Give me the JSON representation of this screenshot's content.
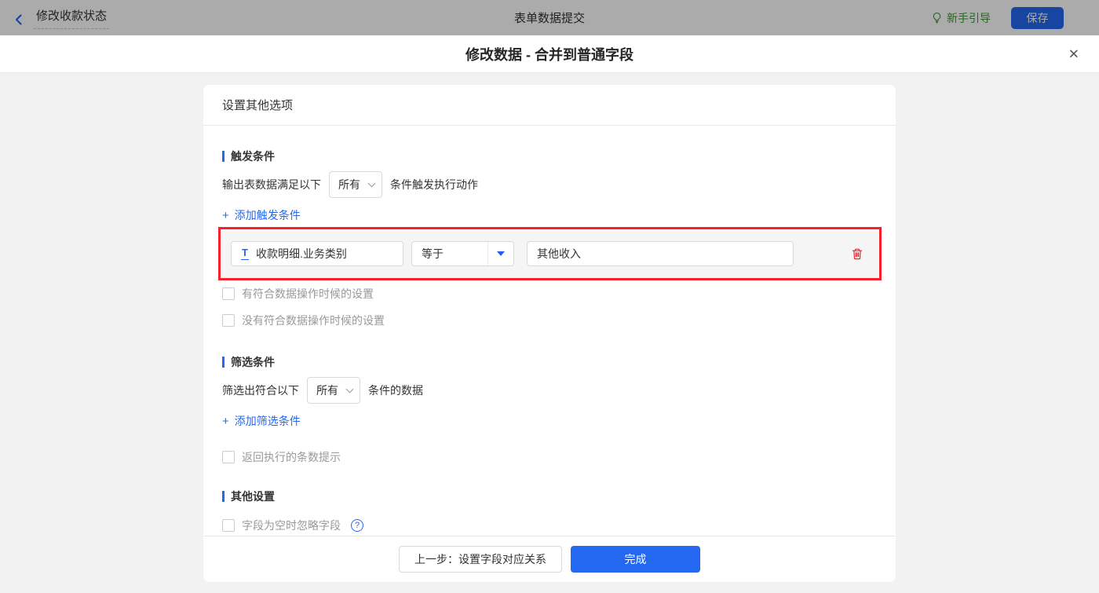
{
  "colors": {
    "accent_blue": "#2468f2",
    "highlight_red": "#f5222d",
    "guide_green": "#3a9c34",
    "body_gray": "#f2f2f2"
  },
  "topbar": {
    "back_label": "修改收款状态",
    "center_title": "表单数据提交",
    "guide_label": "新手引导",
    "save_label": "保存"
  },
  "dialog": {
    "title": "修改数据 - 合并到普通字段",
    "close_icon": "✕"
  },
  "card": {
    "header": "设置其他选项",
    "trigger": {
      "section_title": "触发条件",
      "row_prefix": "输出表数据满足以下",
      "select_value": "所有",
      "row_suffix": "条件触发执行动作",
      "add_label": "添加触发条件",
      "condition": {
        "field_type_icon": "T",
        "field": "收款明细.业务类别",
        "operator": "等于",
        "value": "其他收入"
      },
      "checkboxes": [
        "有符合数据操作时候的设置",
        "没有符合数据操作时候的设置"
      ]
    },
    "filter": {
      "section_title": "筛选条件",
      "row_prefix": "筛选出符合以下",
      "select_value": "所有",
      "row_suffix": "条件的数据",
      "add_label": "添加筛选条件",
      "checkbox": "返回执行的条数提示"
    },
    "other": {
      "section_title": "其他设置",
      "checkbox": "字段为空时忽略字段",
      "help_icon": "?"
    },
    "footer": {
      "prev_label": "上一步：设置字段对应关系",
      "done_label": "完成"
    }
  },
  "icons": {
    "plus": "+"
  }
}
